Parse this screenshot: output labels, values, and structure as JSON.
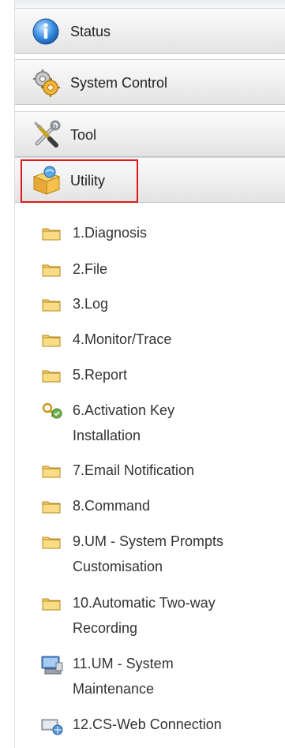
{
  "nav": {
    "sections": [
      {
        "label": "Status",
        "icon": "info-icon"
      },
      {
        "label": "System Control",
        "icon": "gears-icon"
      },
      {
        "label": "Tool",
        "icon": "wrench-screwdriver-icon"
      },
      {
        "label": "Utility",
        "icon": "box-icon",
        "highlighted": true
      }
    ],
    "utility_items": [
      {
        "line1": "1.Diagnosis",
        "icon": "folder-icon"
      },
      {
        "line1": "2.File",
        "icon": "folder-icon"
      },
      {
        "line1": "3.Log",
        "icon": "folder-icon"
      },
      {
        "line1": "4.Monitor/Trace",
        "icon": "folder-icon"
      },
      {
        "line1": "5.Report",
        "icon": "folder-icon"
      },
      {
        "line1": "6.Activation Key",
        "line2": "Installation",
        "icon": "key-icon"
      },
      {
        "line1": "7.Email Notification",
        "icon": "folder-icon"
      },
      {
        "line1": "8.Command",
        "icon": "folder-icon"
      },
      {
        "line1": "9.UM - System Prompts",
        "line2": "Customisation",
        "icon": "folder-icon"
      },
      {
        "line1": "10.Automatic Two-way",
        "line2": "Recording",
        "icon": "folder-icon"
      },
      {
        "line1": "11.UM - System",
        "line2": "Maintenance",
        "icon": "computer-icon"
      },
      {
        "line1": "12.CS-Web Connection",
        "icon": "web-connection-icon"
      }
    ]
  },
  "colors": {
    "highlight_border": "#e01818",
    "folder_fill": "#f5cf6a",
    "folder_edge": "#b88a1c"
  }
}
